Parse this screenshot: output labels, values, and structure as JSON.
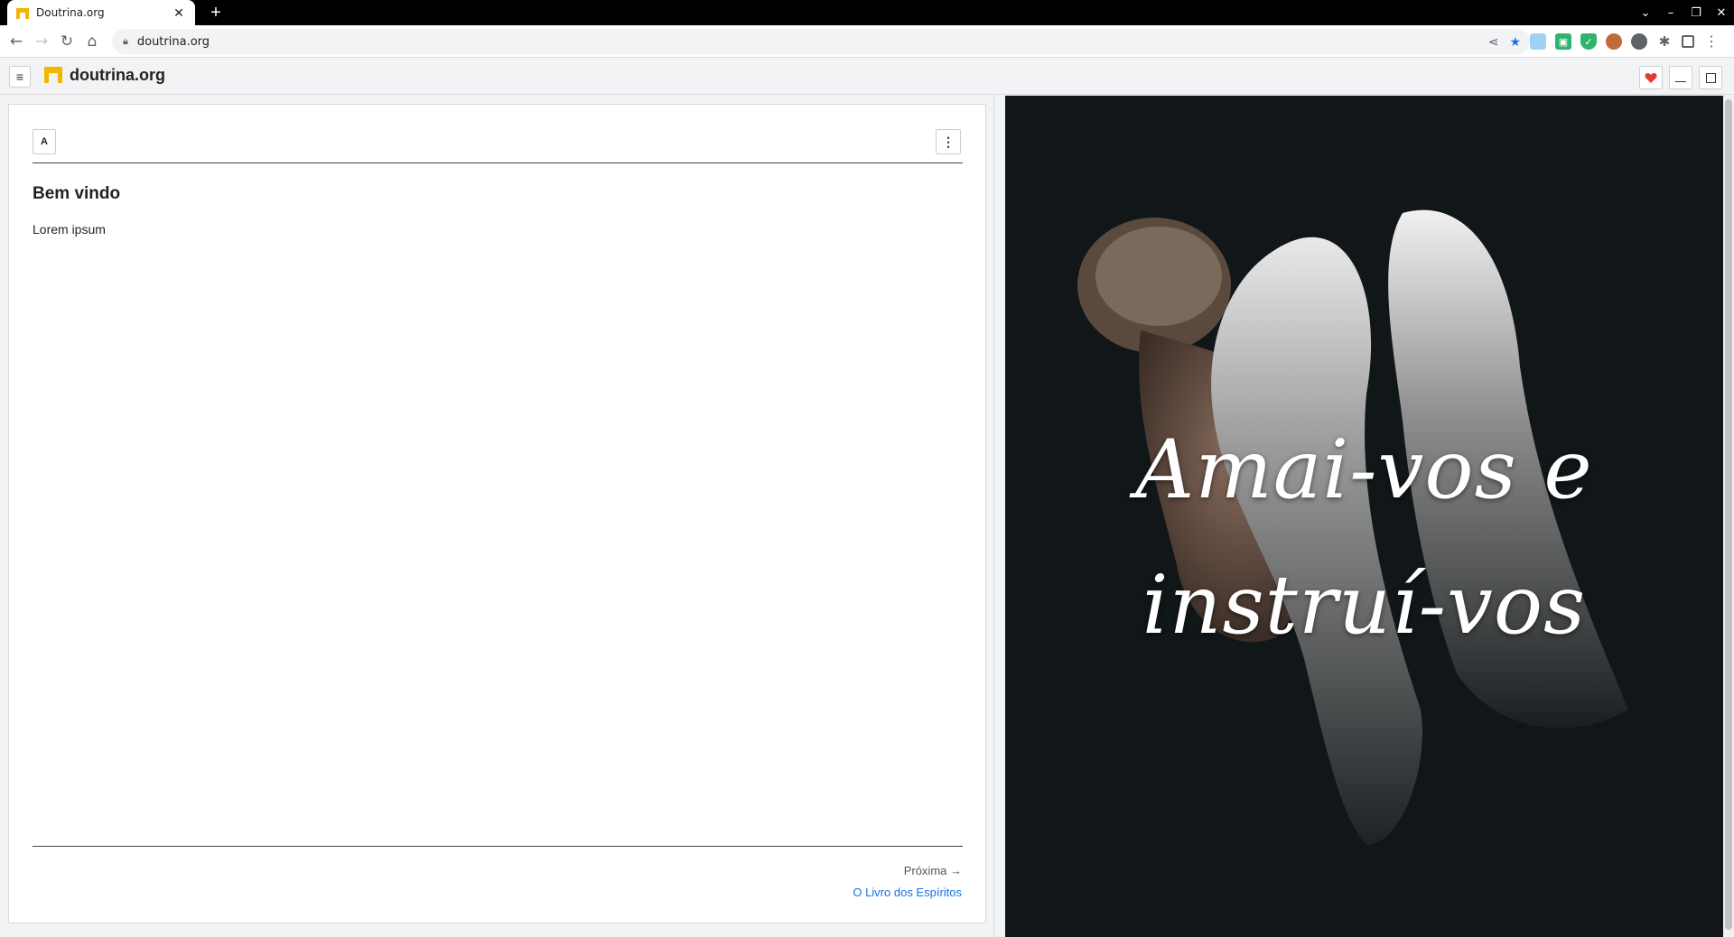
{
  "browser": {
    "tab_title": "Doutrina.org",
    "url": "doutrina.org",
    "window_controls": [
      "⌄",
      "–",
      "❐",
      "✕"
    ]
  },
  "app": {
    "brand_name": "doutrina.org",
    "brand_color": "#f5b400",
    "favorite_color": "#e53935"
  },
  "content": {
    "a_button_label": "A",
    "title": "Bem vindo",
    "body": "Lorem ipsum",
    "next_label": "Próxima →",
    "next_link": "O Livro dos Espíritos"
  },
  "hero": {
    "quote_line1": "Amai-vos e",
    "quote_line2": "instruí-vos"
  }
}
